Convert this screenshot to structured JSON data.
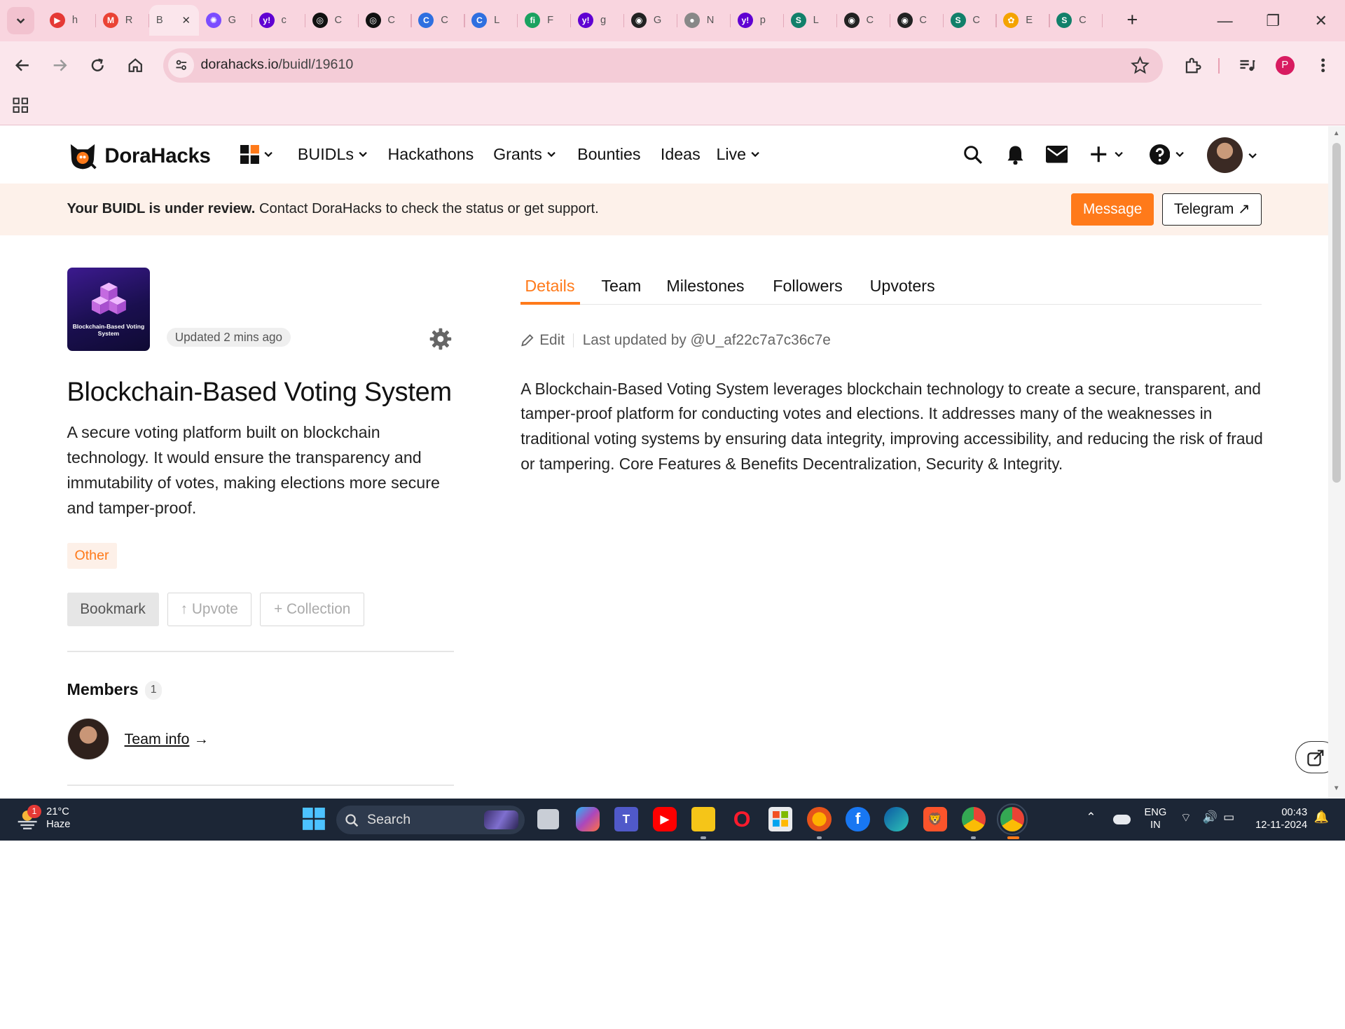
{
  "browser": {
    "tabs": [
      {
        "letter": "h",
        "color": "#e53935",
        "glyph": "▶"
      },
      {
        "letter": "R",
        "color": "#ea4335",
        "glyph": "M"
      },
      {
        "letter": "B",
        "color": "",
        "glyph": "",
        "active": true
      },
      {
        "letter": "G",
        "color": "#7b4dff",
        "glyph": "✺"
      },
      {
        "letter": "c",
        "color": "#6001d2",
        "glyph": "y!"
      },
      {
        "letter": "C",
        "color": "#111111",
        "glyph": "◎"
      },
      {
        "letter": "C",
        "color": "#111111",
        "glyph": "◎"
      },
      {
        "letter": "C",
        "color": "#2f6fe0",
        "glyph": "C"
      },
      {
        "letter": "L",
        "color": "#2f6fe0",
        "glyph": "C"
      },
      {
        "letter": "F",
        "color": "#1aa260",
        "glyph": "fi"
      },
      {
        "letter": "g",
        "color": "#6001d2",
        "glyph": "y!"
      },
      {
        "letter": "G",
        "color": "#222222",
        "glyph": "◉"
      },
      {
        "letter": "N",
        "color": "#888888",
        "glyph": "●"
      },
      {
        "letter": "p",
        "color": "#6001d2",
        "glyph": "y!"
      },
      {
        "letter": "L",
        "color": "#12806a",
        "glyph": "S"
      },
      {
        "letter": "C",
        "color": "#222222",
        "glyph": "◉"
      },
      {
        "letter": "C",
        "color": "#222222",
        "glyph": "◉"
      },
      {
        "letter": "C",
        "color": "#12806a",
        "glyph": "S"
      },
      {
        "letter": "E",
        "color": "#f4a300",
        "glyph": "✿"
      },
      {
        "letter": "C",
        "color": "#12806a",
        "glyph": "S"
      }
    ],
    "url_host": "dorahacks.io",
    "url_path": "/buidl/19610",
    "profile_initial": "P"
  },
  "site": {
    "logo_text": "DoraHacks",
    "nav": {
      "buidls": "BUIDLs",
      "hackathons": "Hackathons",
      "grants": "Grants",
      "bounties": "Bounties",
      "ideas": "Ideas",
      "live": "Live"
    },
    "banner": {
      "bold": "Your BUIDL is under review.",
      "text": " Contact DoraHacks to check the status or get support.",
      "message_btn": "Message",
      "telegram_btn": "Telegram ↗"
    }
  },
  "project": {
    "logo_caption": "Blockchain-Based Voting System",
    "updated": "Updated 2 mins ago",
    "title": "Blockchain-Based Voting System",
    "description": "A secure voting platform built on blockchain technology. It would ensure the transparency and immutability of votes, making elections more secure and tamper-proof.",
    "tag": "Other",
    "bookmark": "Bookmark",
    "upvote": "↑ Upvote",
    "collection": "+ Collection",
    "members_title": "Members",
    "members_count": "1",
    "team_info": "Team info",
    "team_info_arrow": "→"
  },
  "details": {
    "tabs": [
      "Details",
      "Team",
      "Milestones",
      "Followers",
      "Upvoters"
    ],
    "edit": "Edit",
    "last_updated": "Last updated by @U_af22c7a7c36c7e",
    "body": "A Blockchain-Based Voting System leverages blockchain technology to create a secure, transparent, and tamper-proof platform for conducting votes and elections. It addresses many of the weaknesses in traditional voting systems by ensuring data integrity, improving accessibility, and reducing the risk of fraud or tampering. Core Features & Benefits Decentralization, Security & Integrity."
  },
  "taskbar": {
    "weather_badge": "1",
    "temperature": "21°C",
    "condition": "Haze",
    "search": "Search",
    "lang_top": "ENG",
    "lang_bottom": "IN",
    "time": "00:43",
    "date": "12-11-2024"
  }
}
